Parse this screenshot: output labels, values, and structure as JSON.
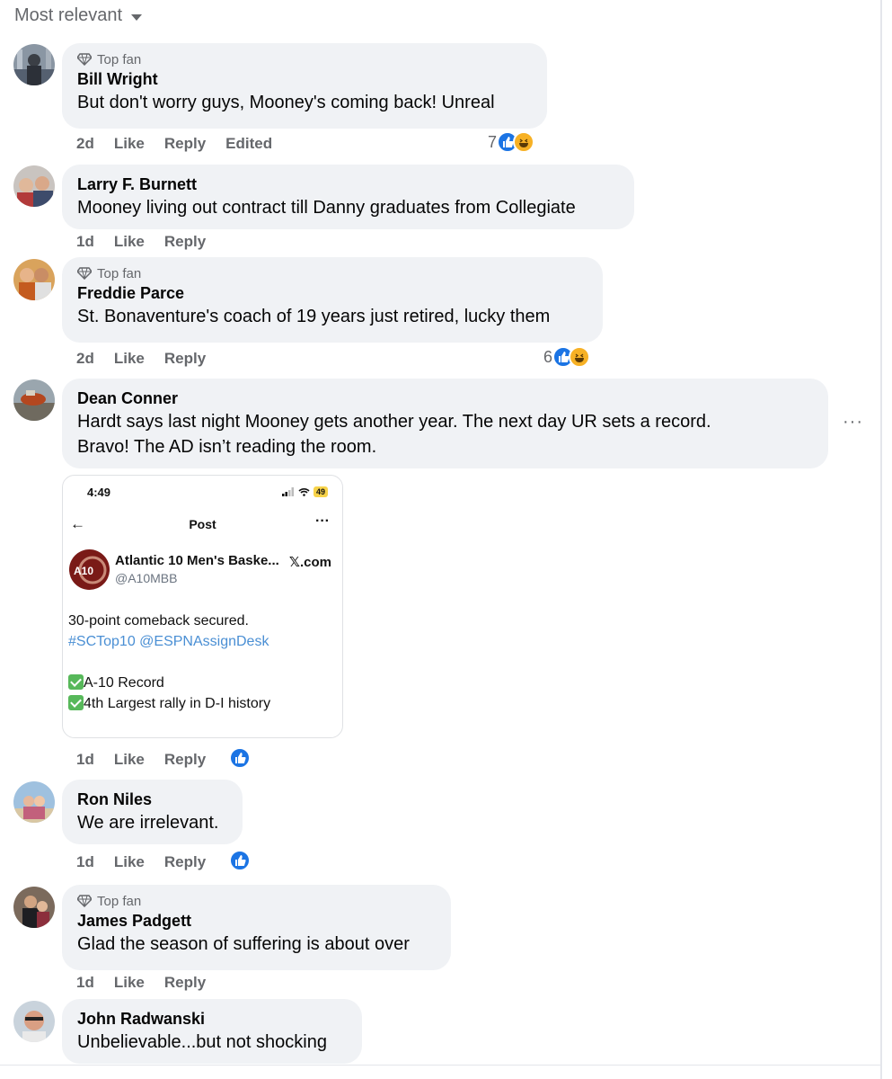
{
  "sort": {
    "label": "Most relevant"
  },
  "top_fan_label": "Top fan",
  "actions": {
    "like": "Like",
    "reply": "Reply",
    "edited": "Edited"
  },
  "comments": [
    {
      "author": "Bill Wright",
      "top_fan": true,
      "text": "But don't worry guys, Mooney's coming back! Unreal",
      "age": "2d",
      "edited": true,
      "reaction_count": "7",
      "reactions": [
        "like-icon",
        "haha-icon"
      ]
    },
    {
      "author": "Larry F. Burnett",
      "top_fan": false,
      "text": "Mooney living out contract till Danny graduates from Collegiate",
      "age": "1d"
    },
    {
      "author": "Freddie Parce",
      "top_fan": true,
      "text": "St. Bonaventure's coach of 19 years just retired, lucky them",
      "age": "2d",
      "reaction_count": "6",
      "reactions": [
        "like-icon",
        "haha-icon"
      ]
    },
    {
      "author": "Dean Conner",
      "top_fan": false,
      "text_lines": [
        "Hardt says last night Mooney gets another year. The next day UR sets a record.",
        "Bravo! The AD isn’t reading the room."
      ],
      "age": "1d",
      "reactions": [
        "like-icon"
      ],
      "attachment": {
        "time": "4:49",
        "battery": "49",
        "post_title": "Post",
        "account_name": "Atlantic 10 Men's Baske...",
        "handle": "@A10MBB",
        "source": "𝕏.com",
        "line1": "30-point comeback secured.",
        "line2": "#SCTop10 @ESPNAssignDesk",
        "line3": "A-10 Record",
        "line4": "4th Largest rally in D-I history",
        "logo_text": "A10"
      }
    },
    {
      "author": "Ron Niles",
      "top_fan": false,
      "text": "We are irrelevant.",
      "age": "1d",
      "reactions": [
        "like-icon"
      ]
    },
    {
      "author": "James Padgett",
      "top_fan": true,
      "text": "Glad the season of suffering is about over",
      "age": "1d"
    },
    {
      "author": "John Radwanski",
      "top_fan": false,
      "text": "Unbelievable...but not shocking"
    }
  ],
  "colors": {
    "bubble": "#f0f2f5",
    "secondary_text": "#65676b",
    "like_blue": "#1b74e4",
    "haha_yellow": "#f7b125",
    "link_blue": "#4a8fd4"
  }
}
